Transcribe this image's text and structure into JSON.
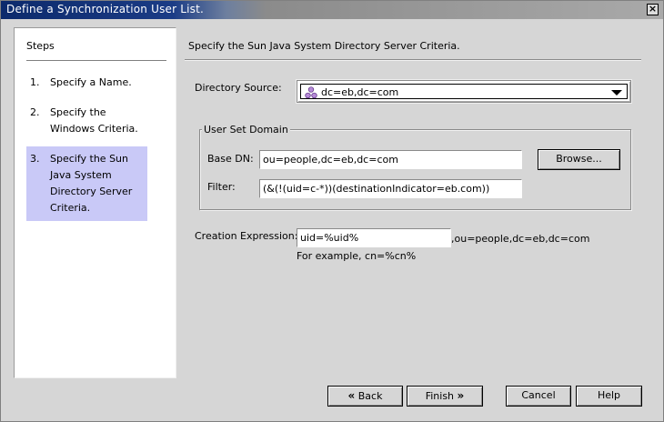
{
  "window": {
    "title": "Define a Synchronization User List.",
    "close_label": "×"
  },
  "steps": {
    "title": "Steps",
    "items": [
      {
        "num": "1.",
        "label": "Specify a Name."
      },
      {
        "num": "2.",
        "label": "Specify the Windows Criteria."
      },
      {
        "num": "3.",
        "label": "Specify the Sun Java System Directory Server Criteria."
      }
    ],
    "active_index": 2,
    "active_color": "#c9c9f7"
  },
  "main": {
    "header": "Specify the Sun Java System Directory Server Criteria.",
    "directory_source": {
      "label": "Directory Source:",
      "value": "dc=eb,dc=com",
      "icon": "directory-server-icon"
    },
    "user_set_domain": {
      "title": "User Set Domain",
      "base_dn_label": "Base DN:",
      "base_dn_value": "ou=people,dc=eb,dc=com",
      "browse_label": "Browse...",
      "filter_label": "Filter:",
      "filter_value": "(&(!(uid=c-*))(destinationIndicator=eb.com))"
    },
    "creation_expression": {
      "label": "Creation Expression:",
      "value": "uid=%uid%",
      "suffix": ",ou=people,dc=eb,dc=com",
      "hint": "For example, cn=%cn%"
    }
  },
  "buttons": {
    "back": "Back",
    "finish": "Finish",
    "cancel": "Cancel",
    "help": "Help"
  }
}
